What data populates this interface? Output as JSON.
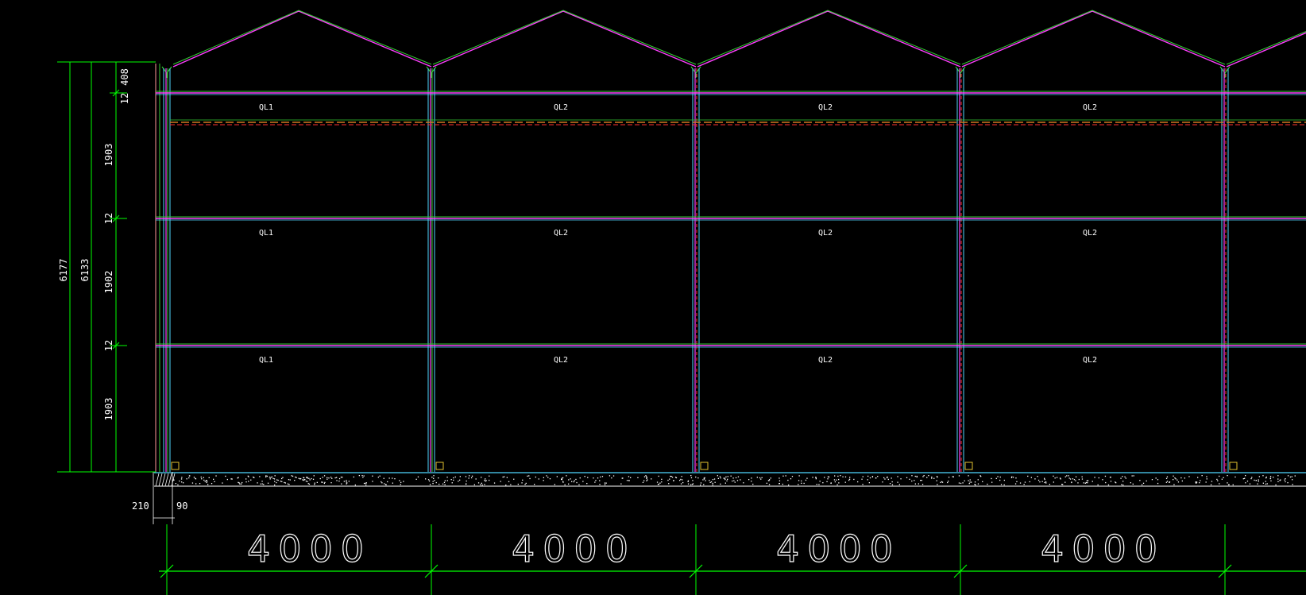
{
  "colors": {
    "background": "#000000",
    "dimension": "#00ff00",
    "roof_magenta": "#ff40ff",
    "roof_green": "#33cc33",
    "column_cyan": "#4fd8ff",
    "column_red": "#ff3030",
    "beam_orange": "#d07a20",
    "ground_white": "#ffffff",
    "text": "#ffffff"
  },
  "bay_dimensions": [
    "4000",
    "4000",
    "4000",
    "4000"
  ],
  "vertical_dims": {
    "overall_1": "6177",
    "overall_2": "6133",
    "segment_top": "408",
    "segment_gap_top": "12",
    "segment_upper": "1903",
    "segment_gap_mid1": "12",
    "segment_middle": "1902",
    "segment_gap_mid2": "12",
    "segment_lower": "1903"
  },
  "base_dims": {
    "left": "210",
    "right": "90"
  },
  "beam_rows": [
    {
      "labels": [
        "QL1",
        "QL2",
        "QL2",
        "QL2"
      ]
    },
    {
      "labels": [
        "QL1",
        "QL2",
        "QL2",
        "QL2"
      ]
    },
    {
      "labels": [
        "QL1",
        "QL2",
        "QL2",
        "QL2"
      ]
    }
  ]
}
